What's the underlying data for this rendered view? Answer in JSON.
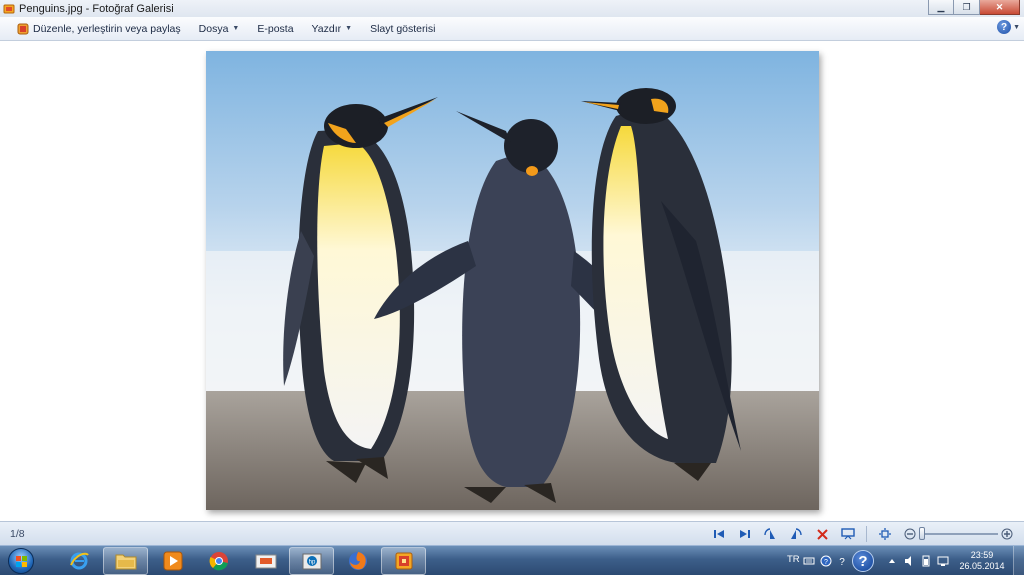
{
  "window": {
    "title": "Penguins.jpg - Fotoğraf Galerisi"
  },
  "menu": {
    "organize_label": "Düzenle, yerleştirin veya paylaş",
    "items": [
      {
        "label": "Dosya"
      },
      {
        "label": "E-posta"
      },
      {
        "label": "Yazdır"
      },
      {
        "label": "Slayt gösterisi"
      }
    ],
    "help_label": "?"
  },
  "photo": {
    "subject": "penguins-photo"
  },
  "controls": {
    "counter": "1/8",
    "zoom_level": 0.0
  },
  "taskbar": {
    "language": "TR",
    "time": "23:59",
    "date": "26.05.2014",
    "help_label": "?"
  },
  "colors": {
    "accent": "#1c4fa8",
    "taskbar": "#3d5f8a"
  }
}
